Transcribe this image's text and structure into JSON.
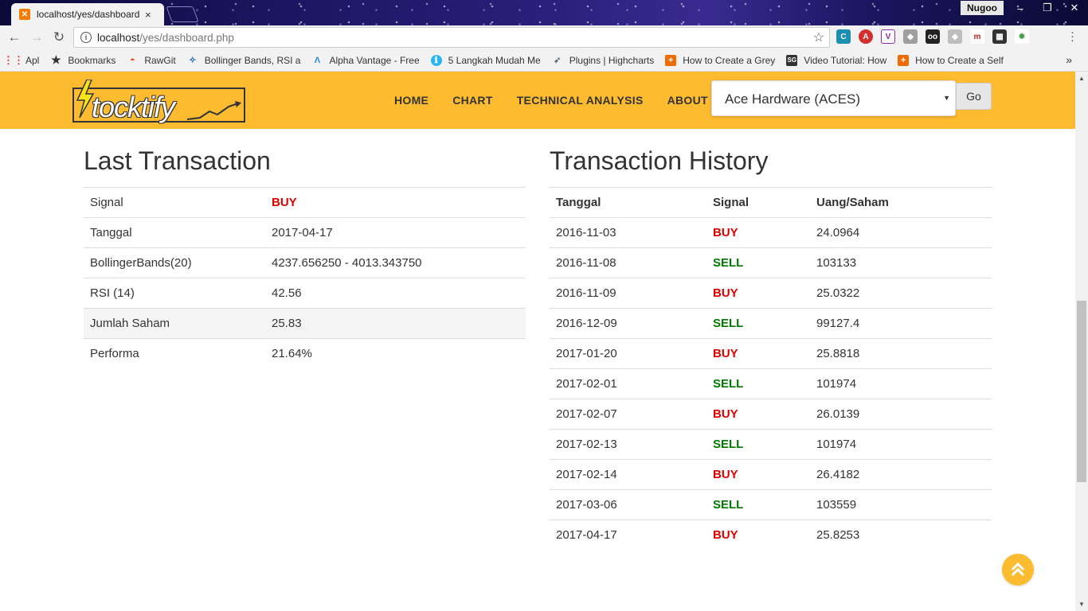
{
  "browser": {
    "tab_title": "localhost/yes/dashboard",
    "tab_close": "×",
    "user_badge": "Nugoo",
    "url_host": "localhost",
    "url_path": "/yes/dashboard.php",
    "bookmarks": [
      {
        "label": "Apl",
        "icon": "apps-grid-icon"
      },
      {
        "label": "Bookmarks",
        "icon": "star-icon"
      },
      {
        "label": "RawGit",
        "icon": "rawgit-icon"
      },
      {
        "label": "Bollinger Bands, RSI a",
        "icon": "bollinger-icon"
      },
      {
        "label": "Alpha Vantage - Free",
        "icon": "alpha-vantage-icon"
      },
      {
        "label": "5 Langkah Mudah Me",
        "icon": "langkah-icon"
      },
      {
        "label": "Plugins | Highcharts",
        "icon": "highcharts-icon"
      },
      {
        "label": "How to Create a Grey",
        "icon": "plus-page-icon"
      },
      {
        "label": "Video Tutorial: How",
        "icon": "sg-icon"
      },
      {
        "label": "How to Create a Self",
        "icon": "plus-page-icon"
      }
    ]
  },
  "site": {
    "logo_text": "tocktify",
    "nav": [
      "HOME",
      "CHART",
      "TECHNICAL ANALYSIS",
      "ABOUT"
    ],
    "stock_selected": "Ace Hardware (ACES)",
    "go_label": "Go"
  },
  "last_transaction": {
    "title": "Last Transaction",
    "rows": [
      {
        "label": "Signal",
        "value": "BUY",
        "signal": true
      },
      {
        "label": "Tanggal",
        "value": "2017-04-17"
      },
      {
        "label": "BollingerBands(20)",
        "value": "4237.656250 - 4013.343750"
      },
      {
        "label": "RSI (14)",
        "value": "42.56"
      },
      {
        "label": "Jumlah Saham",
        "value": "25.83"
      },
      {
        "label": "Performa",
        "value": "21.64%"
      }
    ]
  },
  "history": {
    "title": "Transaction History",
    "headers": [
      "Tanggal",
      "Signal",
      "Uang/Saham"
    ],
    "rows": [
      [
        "2016-11-03",
        "BUY",
        "24.0964"
      ],
      [
        "2016-11-08",
        "SELL",
        "103133"
      ],
      [
        "2016-11-09",
        "BUY",
        "25.0322"
      ],
      [
        "2016-12-09",
        "SELL",
        "99127.4"
      ],
      [
        "2017-01-20",
        "BUY",
        "25.8818"
      ],
      [
        "2017-02-01",
        "SELL",
        "101974"
      ],
      [
        "2017-02-07",
        "BUY",
        "26.0139"
      ],
      [
        "2017-02-13",
        "SELL",
        "101974"
      ],
      [
        "2017-02-14",
        "BUY",
        "26.4182"
      ],
      [
        "2017-03-06",
        "SELL",
        "103559"
      ],
      [
        "2017-04-17",
        "BUY",
        "25.8253"
      ]
    ]
  },
  "colors": {
    "brand": "#fdbb2f",
    "buy": "#e00000",
    "sell": "#007a00"
  }
}
